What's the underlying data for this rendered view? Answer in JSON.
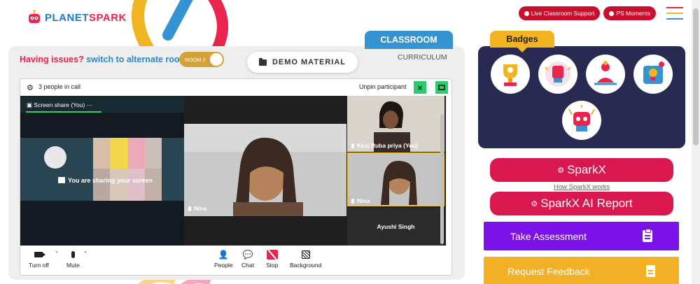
{
  "brand": {
    "logo_part1": "PLANET",
    "logo_part2": "SPARK"
  },
  "header": {
    "live_support_label": "Live Classroom Support",
    "ps_moments_label": "PS Moments"
  },
  "tabs": {
    "classroom": "CLASSROOM",
    "curriculum": "CURRICULUM"
  },
  "issues": {
    "prefix": "Having issues?",
    "link": "switch to alternate room",
    "room_toggle": "ROOM 2"
  },
  "demo_material_label": "DEMO MATERIAL",
  "meeting": {
    "people_count": "3 people in call",
    "unpin_label": "Unpin participant",
    "screen_share_label": "Screen share (You)",
    "screen_share_menu": "⋯",
    "sharing_message": "You are sharing your screen",
    "main_participant": "Nina",
    "participants": [
      {
        "name": "Kezi Ruba priya (You)"
      },
      {
        "name": "Nina"
      },
      {
        "name": "Ayushi Singh"
      }
    ],
    "controls": [
      {
        "id": "camera",
        "label": "Turn off"
      },
      {
        "id": "mic",
        "label": "Mute"
      },
      {
        "id": "people",
        "label": "People"
      },
      {
        "id": "chat",
        "label": "Chat"
      },
      {
        "id": "stop",
        "label": "Stop"
      },
      {
        "id": "background",
        "label": "Background"
      }
    ]
  },
  "sidebar": {
    "badges_title": "Badges",
    "sparkx_label": "SparkX",
    "how_sparkx_link": "How SparkX works",
    "sparkx_ai_label": "SparkX AI Report",
    "assessment_label": "Take Assessment",
    "feedback_label": "Request Feedback"
  },
  "colors": {
    "brand_red": "#d8184f",
    "brand_blue": "#3593d1",
    "brand_yellow": "#f2b422",
    "badges_bg": "#282a52",
    "assessment_purple": "#7b12e8",
    "active_green": "#2ecc71"
  }
}
